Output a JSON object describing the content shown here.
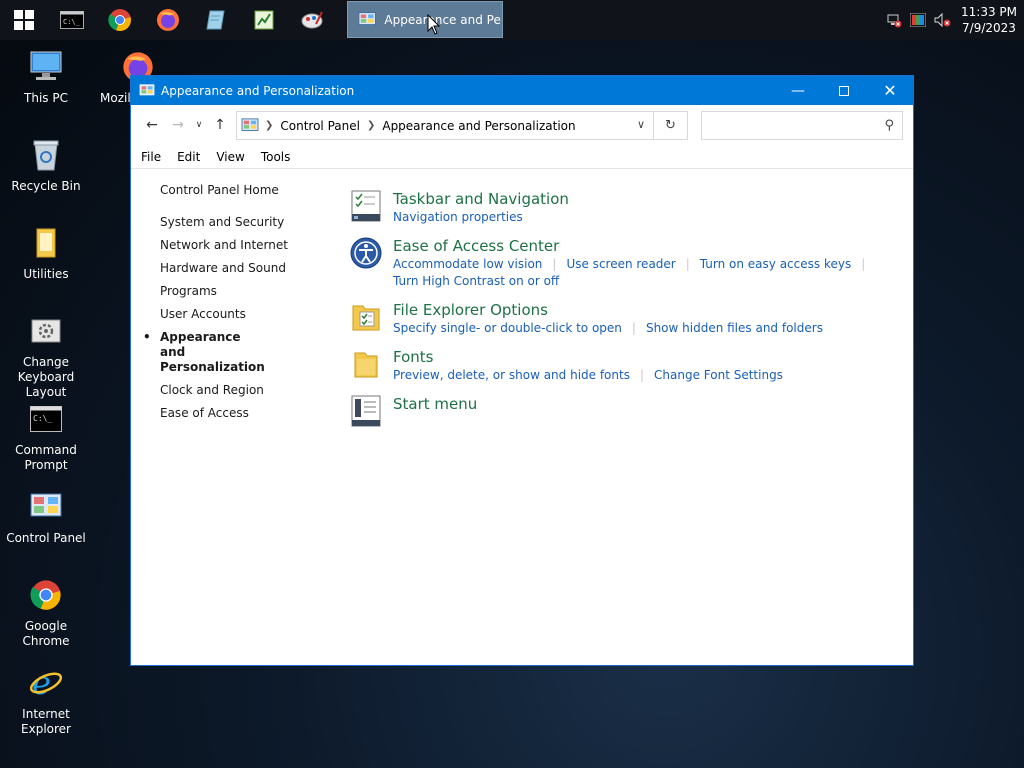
{
  "taskbar": {
    "pinned": [
      {
        "name": "windows-start",
        "icon": "windows-logo-icon"
      },
      {
        "name": "command-prompt",
        "icon": "terminal-icon"
      },
      {
        "name": "google-chrome",
        "icon": "chrome-icon"
      },
      {
        "name": "firefox",
        "icon": "firefox-icon"
      },
      {
        "name": "notepad",
        "icon": "notepad-icon"
      },
      {
        "name": "spreadsheet",
        "icon": "spreadsheet-icon"
      },
      {
        "name": "paint",
        "icon": "paint-icon"
      }
    ],
    "active_window_label": "Appearance and Pe...",
    "clock_time": "11:33 PM",
    "clock_date": "7/9/2023"
  },
  "desktop": {
    "icons": [
      {
        "label": "This PC",
        "icon": "computer-icon"
      },
      {
        "label": "Recycle Bin",
        "icon": "recycle-bin-icon"
      },
      {
        "label": "Utilities",
        "icon": "folder-icon"
      },
      {
        "label": "Change Keyboard Layout",
        "icon": "keyboard-settings-icon"
      },
      {
        "label": "Command Prompt",
        "icon": "terminal-icon"
      },
      {
        "label": "Control Panel",
        "icon": "control-panel-icon"
      },
      {
        "label": "Google Chrome",
        "icon": "chrome-icon"
      },
      {
        "label": "Internet Explorer",
        "icon": "internet-explorer-icon"
      },
      {
        "label": "Mozil",
        "icon": "firefox-icon"
      }
    ]
  },
  "window": {
    "title": "Appearance and Personalization",
    "breadcrumb": [
      "Control Panel",
      "Appearance and Personalization"
    ],
    "search_placeholder": "",
    "menu": [
      "File",
      "Edit",
      "View",
      "Tools"
    ],
    "sidebar": {
      "home": "Control Panel Home",
      "items": [
        "System and Security",
        "Network and Internet",
        "Hardware and Sound",
        "Programs",
        "User Accounts",
        "Appearance and Personalization",
        "Clock and Region",
        "Ease of Access"
      ]
    },
    "categories": [
      {
        "title": "Taskbar and Navigation",
        "icon": "taskbar-icon",
        "links": [
          "Navigation properties"
        ]
      },
      {
        "title": "Ease of Access Center",
        "icon": "ease-of-access-icon",
        "links": [
          "Accommodate low vision",
          "Use screen reader",
          "Turn on easy access keys",
          "Turn High Contrast on or off"
        ]
      },
      {
        "title": "File Explorer Options",
        "icon": "folder-options-icon",
        "links": [
          "Specify single- or double-click to open",
          "Show hidden files and folders"
        ]
      },
      {
        "title": "Fonts",
        "icon": "fonts-folder-icon",
        "links": [
          "Preview, delete, or show and hide fonts",
          "Change Font Settings"
        ]
      },
      {
        "title": "Start menu",
        "icon": "start-menu-icon",
        "links": []
      }
    ]
  },
  "colors": {
    "titlebar": "#0078d7",
    "category_title": "#1e7145",
    "link": "#1a5fb4"
  }
}
